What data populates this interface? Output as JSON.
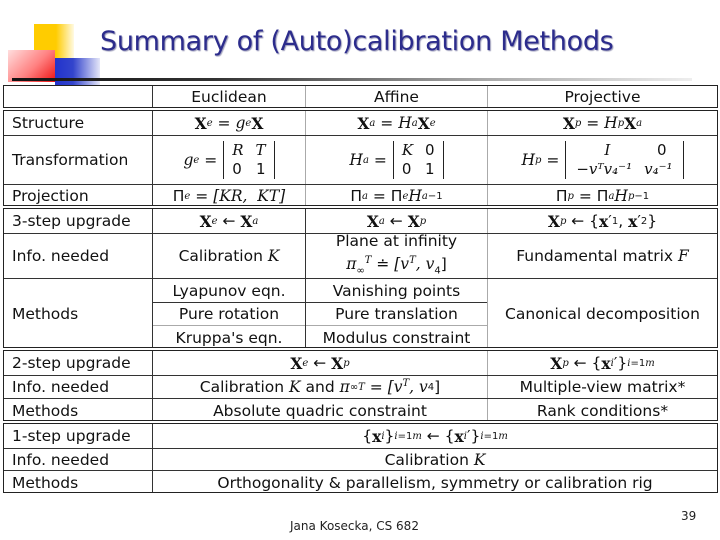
{
  "slide": {
    "title": "Summary of (Auto)calibration Methods",
    "footer": "Jana Kosecka, CS 682",
    "page_number": "39",
    "colors": {
      "title": "#2c2c8c",
      "deco_yellow": "#ffcc00",
      "deco_red": "#ee1111",
      "deco_blue": "#2233cc"
    }
  },
  "table": {
    "columns": [
      "",
      "Euclidean",
      "Affine",
      "Projective"
    ],
    "block1": {
      "structure": {
        "label": "Structure",
        "euclidean": "X_e = g_e X",
        "affine": "X_a = H_a X_e",
        "projective": "X_p = H_p X_a"
      },
      "transformation": {
        "label": "Transformation",
        "euclidean": {
          "lhs": "g_e =",
          "m11": "R",
          "m12": "T",
          "m21": "0",
          "m22": "1"
        },
        "affine": {
          "lhs": "H_a =",
          "m11": "K",
          "m12": "0",
          "m21": "0",
          "m22": "1"
        },
        "projective": {
          "lhs": "H_p =",
          "m11": "I",
          "m12": "0",
          "m21": "−vᵀv₄⁻¹",
          "m22": "v₄⁻¹"
        }
      },
      "projection": {
        "label": "Projection",
        "euclidean": "Π_e = [KR, KT]",
        "affine": "Π_a = Π_e H_a⁻¹",
        "projective": "Π_p = Π_a H_p⁻¹"
      }
    },
    "block2": {
      "upgrade": {
        "label": "3-step upgrade",
        "euclidean": "X_e ← X_a",
        "affine": "X_a ← X_p",
        "projective": "X_p ← {x′₁, x′₂}"
      },
      "info": {
        "label": "Info. needed",
        "euclidean": "Calibration K",
        "affine_line1": "Plane at infinity",
        "affine_line2": "π∞ᵀ ≐ [vᵀ, v₄]",
        "projective": "Fundamental matrix F"
      },
      "methods": {
        "label": "Methods",
        "euclidean": [
          "Lyapunov eqn.",
          "Pure rotation",
          "Kruppa's eqn."
        ],
        "affine": [
          "Vanishing points",
          "Pure translation",
          "Modulus constraint"
        ],
        "projective": "Canonical decomposition"
      }
    },
    "block3": {
      "upgrade": {
        "label": "2-step upgrade",
        "euclid_affine": "X_e ← X_p",
        "projective": "X_p ← {x′ᵢ} i=1..m"
      },
      "info": {
        "label": "Info. needed",
        "euclid_affine": "Calibration K and π∞ᵀ = [vᵀ, v₄]",
        "projective": "Multiple-view matrix*"
      },
      "methods": {
        "label": "Methods",
        "euclid_affine": "Absolute quadric constraint",
        "projective": "Rank conditions*"
      }
    },
    "block4": {
      "upgrade": {
        "label": "1-step upgrade",
        "all": "{xᵢ} i=1..m ← {x′ᵢ} i=1..m"
      },
      "info": {
        "label": "Info. needed",
        "all": "Calibration K"
      },
      "methods": {
        "label": "Methods",
        "all": "Orthogonality & parallelism, symmetry or calibration rig"
      }
    }
  }
}
